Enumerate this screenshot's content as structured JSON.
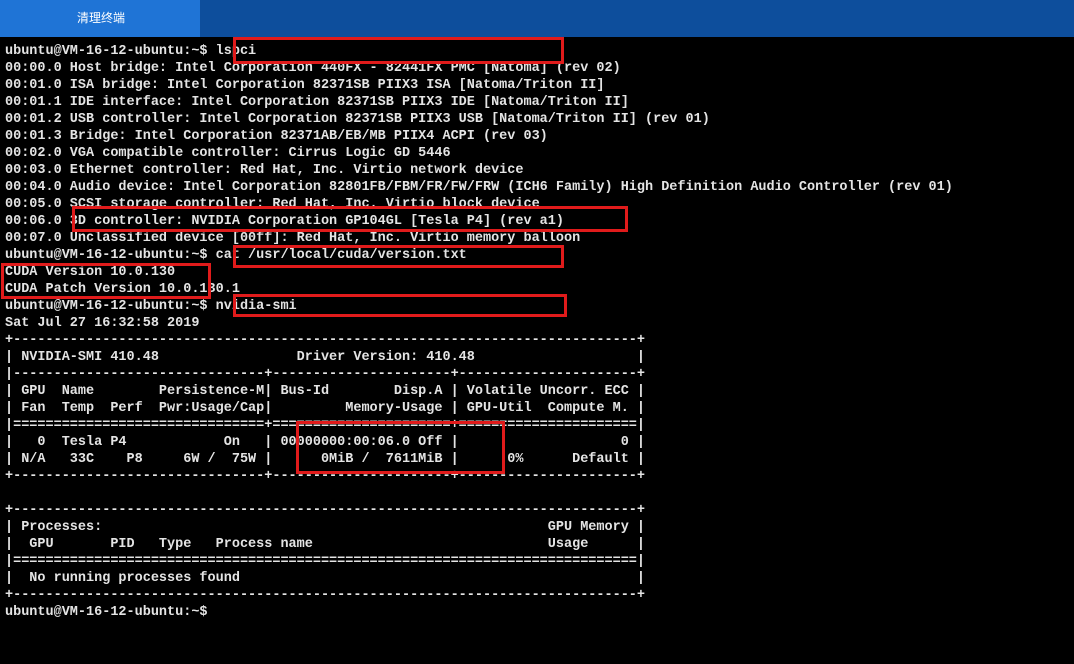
{
  "tab": {
    "label": "清理终端"
  },
  "terminal": {
    "lines": [
      "ubuntu@VM-16-12-ubuntu:~$ lspci",
      "00:00.0 Host bridge: Intel Corporation 440FX - 82441FX PMC [Natoma] (rev 02)",
      "00:01.0 ISA bridge: Intel Corporation 82371SB PIIX3 ISA [Natoma/Triton II]",
      "00:01.1 IDE interface: Intel Corporation 82371SB PIIX3 IDE [Natoma/Triton II]",
      "00:01.2 USB controller: Intel Corporation 82371SB PIIX3 USB [Natoma/Triton II] (rev 01)",
      "00:01.3 Bridge: Intel Corporation 82371AB/EB/MB PIIX4 ACPI (rev 03)",
      "00:02.0 VGA compatible controller: Cirrus Logic GD 5446",
      "00:03.0 Ethernet controller: Red Hat, Inc. Virtio network device",
      "00:04.0 Audio device: Intel Corporation 82801FB/FBM/FR/FW/FRW (ICH6 Family) High Definition Audio Controller (rev 01)",
      "00:05.0 SCSI storage controller: Red Hat, Inc. Virtio block device",
      "00:06.0 3D controller: NVIDIA Corporation GP104GL [Tesla P4] (rev a1)",
      "00:07.0 Unclassified device [00ff]: Red Hat, Inc. Virtio memory balloon",
      "ubuntu@VM-16-12-ubuntu:~$ cat /usr/local/cuda/version.txt",
      "CUDA Version 10.0.130",
      "CUDA Patch Version 10.0.130.1",
      "ubuntu@VM-16-12-ubuntu:~$ nvidia-smi",
      "Sat Jul 27 16:32:58 2019",
      "+-----------------------------------------------------------------------------+",
      "| NVIDIA-SMI 410.48                 Driver Version: 410.48                    |",
      "|-------------------------------+----------------------+----------------------+",
      "| GPU  Name        Persistence-M| Bus-Id        Disp.A | Volatile Uncorr. ECC |",
      "| Fan  Temp  Perf  Pwr:Usage/Cap|         Memory-Usage | GPU-Util  Compute M. |",
      "|===============================+======================+======================|",
      "|   0  Tesla P4            On   | 00000000:00:06.0 Off |                    0 |",
      "| N/A   33C    P8     6W /  75W |      0MiB /  7611MiB |      0%      Default |",
      "+-------------------------------+----------------------+----------------------+",
      "",
      "+-----------------------------------------------------------------------------+",
      "| Processes:                                                       GPU Memory |",
      "|  GPU       PID   Type   Process name                             Usage      |",
      "|=============================================================================|",
      "|  No running processes found                                                 |",
      "+-----------------------------------------------------------------------------+",
      "ubuntu@VM-16-12-ubuntu:~$"
    ]
  },
  "colors": {
    "topbar": "#0d4e9c",
    "tab_active": "#1f74d6",
    "highlight": "#e01b1b",
    "terminal_bg": "#000000",
    "terminal_fg": "#e4e4e4"
  }
}
